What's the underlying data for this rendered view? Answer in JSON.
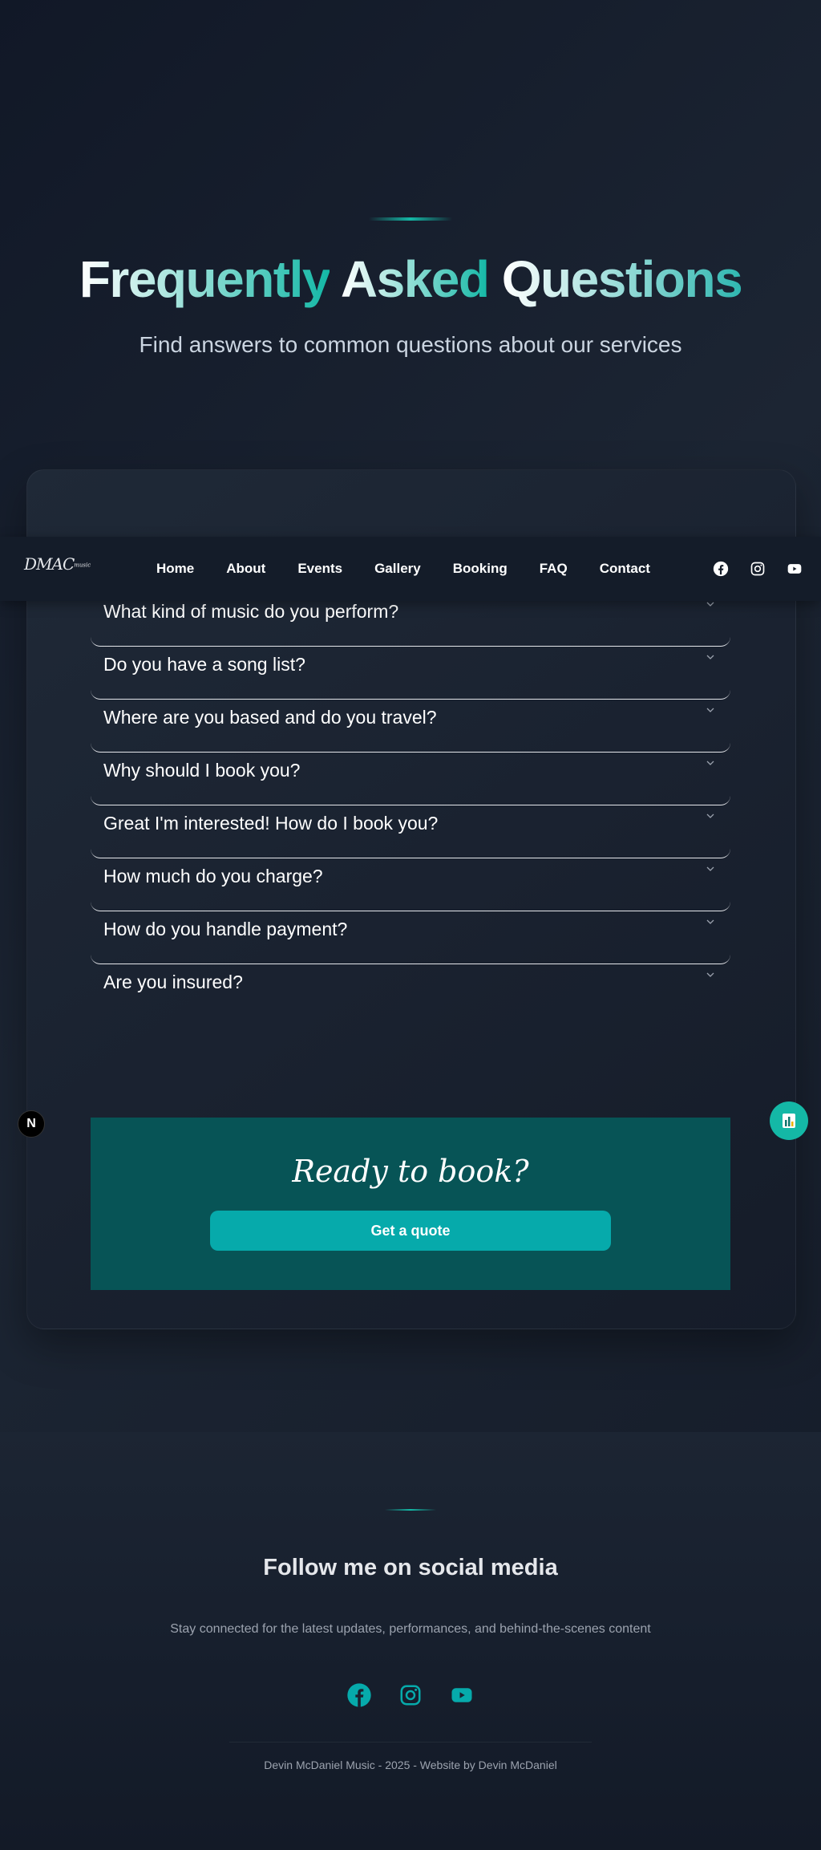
{
  "hero": {
    "title_word1": "Frequently",
    "title_word2": "Asked",
    "title_word3": "Questions",
    "subtitle": "Find answers to common questions about our services"
  },
  "nav": {
    "logo": "DMAC",
    "logo_small": "music",
    "links": [
      "Home",
      "About",
      "Events",
      "Gallery",
      "Booking",
      "FAQ",
      "Contact"
    ],
    "social_icons": [
      "facebook-icon",
      "instagram-icon",
      "youtube-icon"
    ]
  },
  "faq": {
    "questions": [
      "What kind of music do you perform?",
      "Do you have a song list?",
      "Where are you based and do you travel?",
      "Why should I book you?",
      "Great I'm interested! How do I book you?",
      "How much do you charge?",
      "How do you handle payment?",
      "Are you insured?"
    ]
  },
  "cta": {
    "title": "Ready to book?",
    "button": "Get a quote"
  },
  "badge": {
    "letter": "N"
  },
  "social": {
    "title": "Follow me on social media",
    "subtitle": "Stay connected for the latest updates, performances, and behind-the-scenes content",
    "icons": [
      "facebook-icon",
      "instagram-icon",
      "youtube-icon"
    ],
    "accent_color": "#14b8a6"
  },
  "footer": {
    "text": "Devin McDaniel Music - 2025 - Website by Devin McDaniel"
  },
  "colors": {
    "accent": "#14b8a6",
    "cta_bg": "#075456",
    "cta_button": "#06aaab"
  }
}
